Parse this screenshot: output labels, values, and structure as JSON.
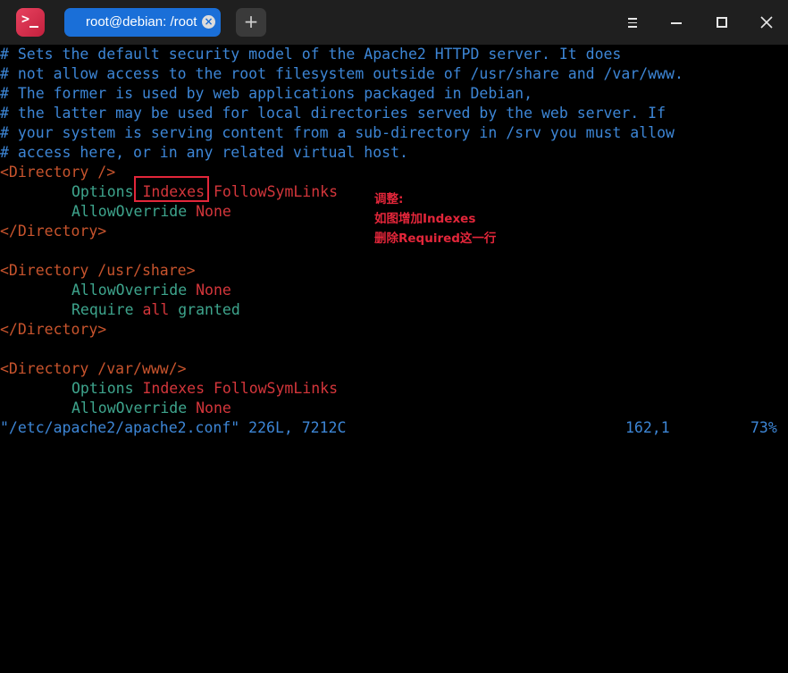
{
  "window": {
    "tab_title": "root@debian: /root",
    "app_icon_glyph": ">_",
    "new_tab_glyph": "+",
    "close_tab_glyph": "×",
    "colors": {
      "titlebar": "#1f1f1f",
      "tab_active": "#1a6fd8",
      "app_icon": "#e03a55"
    }
  },
  "terminal": {
    "comments": [
      "# Sets the default security model of the Apache2 HTTPD server. It does",
      "# not allow access to the root filesystem outside of /usr/share and /var/www.",
      "# The former is used by web applications packaged in Debian,",
      "# the latter may be used for local directories served by the web server. If",
      "# your system is serving content from a sub-directory in /srv you must allow",
      "# access here, or in any related virtual host."
    ],
    "block1": {
      "open": "<Directory />",
      "options_key": "Options",
      "options_val1": "Indexes",
      "options_val2": "FollowSymLinks",
      "override_key": "AllowOverride",
      "override_val": "None",
      "close": "</Directory>"
    },
    "block2": {
      "open": "<Directory /usr/share>",
      "override_key": "AllowOverride",
      "override_val": "None",
      "require_key": "Require",
      "require_val1": "all",
      "require_val2": "granted",
      "close": "</Directory>"
    },
    "block3": {
      "open": "<Directory /var/www/>",
      "options_key": "Options",
      "options_val": "Indexes FollowSymLinks",
      "override_key": "AllowOverride",
      "override_val": "None"
    },
    "status": {
      "file": "\"/etc/apache2/apache2.conf\" 226L, 7212C",
      "position": "162,1",
      "percent": "73%"
    },
    "colors": {
      "comment": "#3d86d6",
      "tag": "#c8542d",
      "directive": "#3ea58d",
      "value": "#d4363b",
      "annotation": "#e3263a"
    }
  },
  "annotation": {
    "line1": "调整:",
    "line2": "如图增加Indexes",
    "line3": "删除Required这一行"
  }
}
